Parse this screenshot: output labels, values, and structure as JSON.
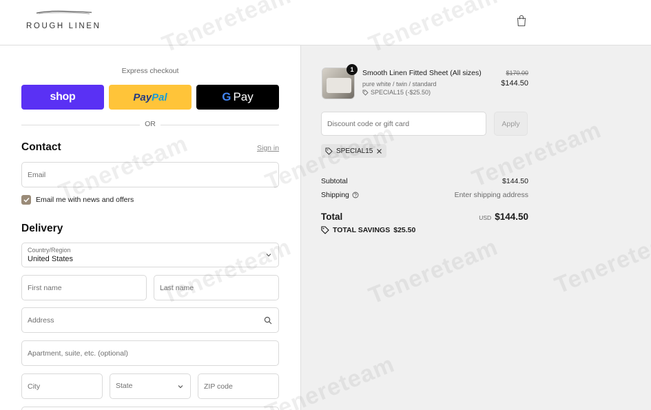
{
  "header": {
    "brand": "ROUGH LINEN",
    "icons": {
      "logo": "logo-swoosh",
      "cart": "shopping-bag-icon"
    }
  },
  "express": {
    "title": "Express checkout",
    "shop_label": "shop",
    "paypal_part1": "Pay",
    "paypal_part2": "Pal",
    "gpay_g": "G",
    "gpay_label": "Pay",
    "or_label": "OR"
  },
  "contact": {
    "title": "Contact",
    "signin_label": "Sign in",
    "email_placeholder": "Email",
    "news_label": "Email me with news and offers",
    "news_checked": true
  },
  "delivery": {
    "title": "Delivery",
    "country_label": "Country/Region",
    "country_value": "United States",
    "first_name_placeholder": "First name",
    "last_name_placeholder": "Last name",
    "address_placeholder": "Address",
    "apartment_placeholder": "Apartment, suite, etc. (optional)",
    "city_placeholder": "City",
    "state_label": "State",
    "zip_placeholder": "ZIP code"
  },
  "summary": {
    "item": {
      "quantity": "1",
      "name": "Smooth Linen Fitted Sheet (All sizes)",
      "variant": "pure white / twin / standard",
      "discount": "SPECIAL15 (-$25.50)",
      "original_price": "$170.00",
      "price": "$144.50"
    },
    "discount_placeholder": "Discount code or gift card",
    "apply_label": "Apply",
    "applied_code": "SPECIAL15",
    "subtotal_label": "Subtotal",
    "subtotal_value": "$144.50",
    "shipping_label": "Shipping",
    "shipping_value": "Enter shipping address",
    "total_label": "Total",
    "currency": "USD",
    "total_value": "$144.50",
    "savings_label": "TOTAL SAVINGS",
    "savings_value": "$25.50"
  },
  "watermark_text": "Tenereteam",
  "colors": {
    "shop": "#5a31f4",
    "paypal": "#ffc439",
    "paypal_dark": "#253b80",
    "paypal_light": "#179bd7",
    "gpay": "#000000",
    "checkbox": "#9a8b78",
    "summary_bg": "#f0f0f0"
  }
}
